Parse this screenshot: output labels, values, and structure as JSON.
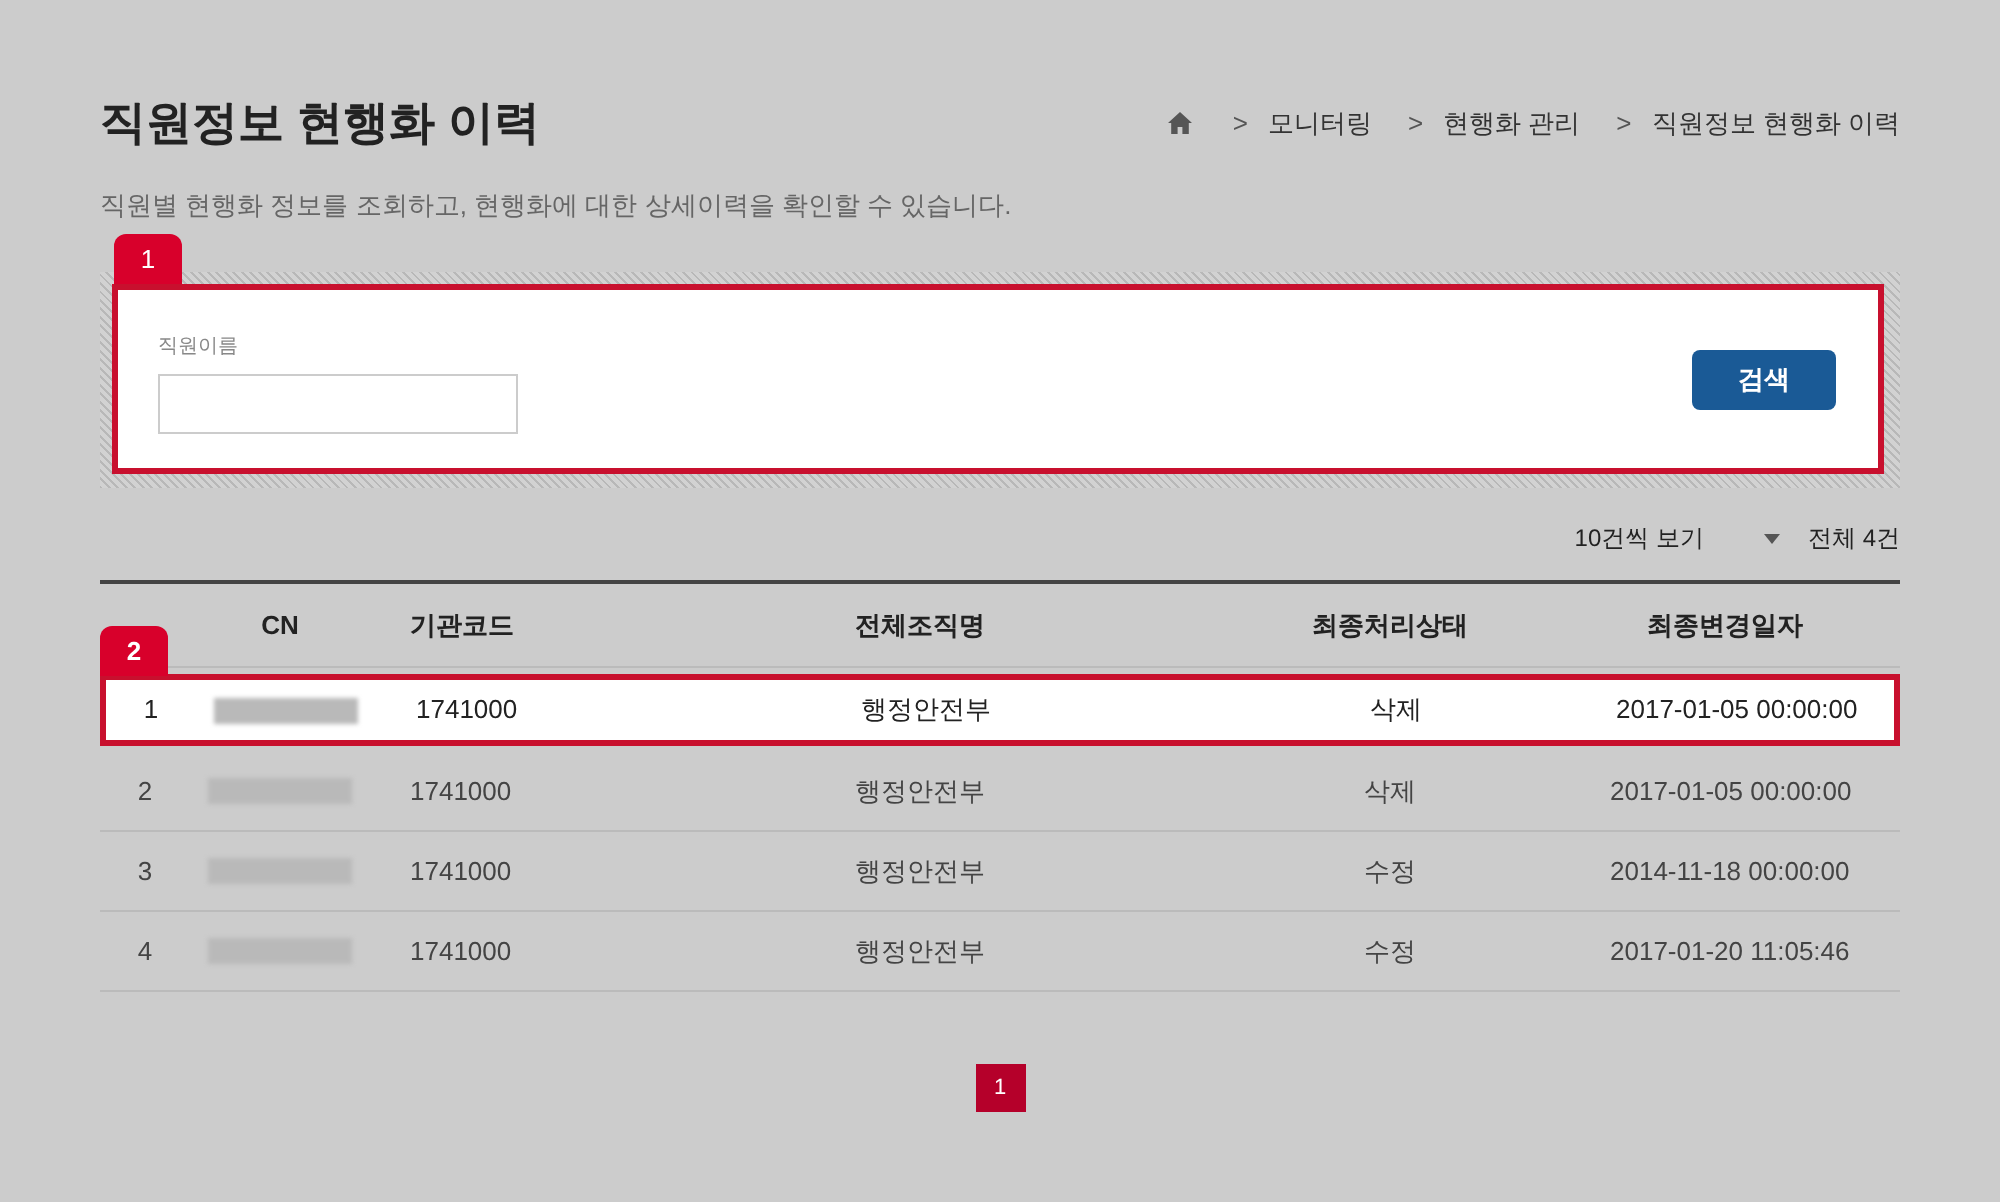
{
  "page": {
    "title": "직원정보 현행화 이력",
    "description": "직원별 현행화 정보를 조회하고, 현행화에 대한 상세이력을 확인할 수 있습니다."
  },
  "breadcrumb": [
    {
      "separator": ">",
      "label": "모니터링"
    },
    {
      "separator": ">",
      "label": "현행화 관리"
    },
    {
      "separator": ">",
      "label": "직원정보 현행화 이력"
    }
  ],
  "search": {
    "annotation": "1",
    "label": "직원이름",
    "button": "검색"
  },
  "list_controls": {
    "page_size": "10건씩 보기",
    "total": "전체 4건"
  },
  "table": {
    "annotation": "2",
    "columns": [
      "CN",
      "기관코드",
      "전체조직명",
      "최종처리상태",
      "최종변경일자"
    ],
    "rows": [
      {
        "no": "1",
        "code": "1741000",
        "org": "행정안전부",
        "status": "삭제",
        "date": "2017-01-05 00:00:00",
        "highlighted": true
      },
      {
        "no": "2",
        "code": "1741000",
        "org": "행정안전부",
        "status": "삭제",
        "date": "2017-01-05 00:00:00",
        "highlighted": false
      },
      {
        "no": "3",
        "code": "1741000",
        "org": "행정안전부",
        "status": "수정",
        "date": "2014-11-18 00:00:00",
        "highlighted": false
      },
      {
        "no": "4",
        "code": "1741000",
        "org": "행정안전부",
        "status": "수정",
        "date": "2017-01-20 11:05:46",
        "highlighted": false
      }
    ]
  },
  "pagination": [
    {
      "label": "1",
      "selected": true
    }
  ]
}
